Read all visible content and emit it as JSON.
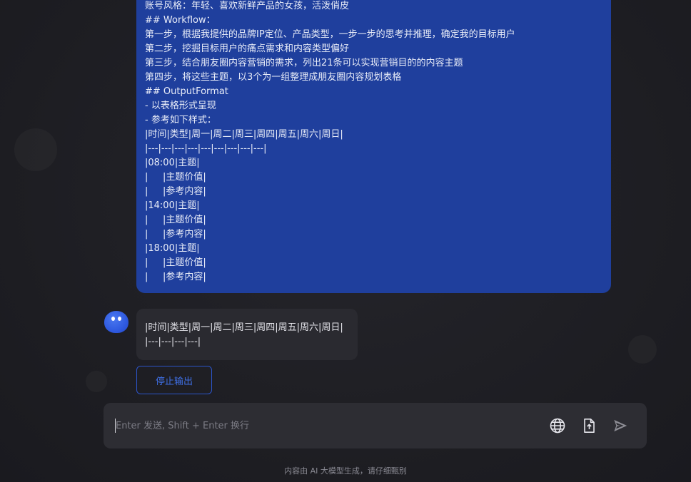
{
  "user_message": {
    "lines": [
      "账号风格：年轻、喜欢新鲜产品的女孩，活泼俏皮",
      "## Workflow：",
      "第一步，根据我提供的品牌IP定位、产品类型，一步一步的思考并推理，确定我的目标用户",
      "第二步，挖掘目标用户的痛点需求和内容类型偏好",
      "第三步，结合朋友圈内容营销的需求，列出21条可以实现营销目的的内容主题",
      "第四步，将这些主题，以3个为一组整理成朋友圈内容规划表格",
      "## OutputFormat",
      "- 以表格形式呈现",
      "- 参考如下样式：",
      "|时间|类型|周一|周二|周三|周四|周五|周六|周日|",
      "|---|---|---|---|---|---|---|---|---|",
      "|08:00|主题|",
      "|     |主题价值|",
      "|     |参考内容|",
      "|14:00|主题|",
      "|     |主题价值|",
      "|     |参考内容|",
      "|18:00|主题|",
      "|     |主题价值|",
      "|     |参考内容|"
    ]
  },
  "bot_message": {
    "lines": [
      "|时间|类型|周一|周二|周三|周四|周五|周六|周日|",
      "|---|---|---|---|"
    ]
  },
  "stop_button": {
    "label": "停止输出"
  },
  "composer": {
    "placeholder": "Enter 发送, Shift + Enter 换行",
    "icons": [
      "globe-icon",
      "upload-file-icon",
      "send-icon"
    ]
  },
  "footer": {
    "disclaimer": "内容由 AI 大模型生成，请仔细甄别"
  },
  "colors": {
    "user_bubble": "#1f3f9d",
    "accent": "#2c54c8",
    "background": "#1f1f24"
  }
}
